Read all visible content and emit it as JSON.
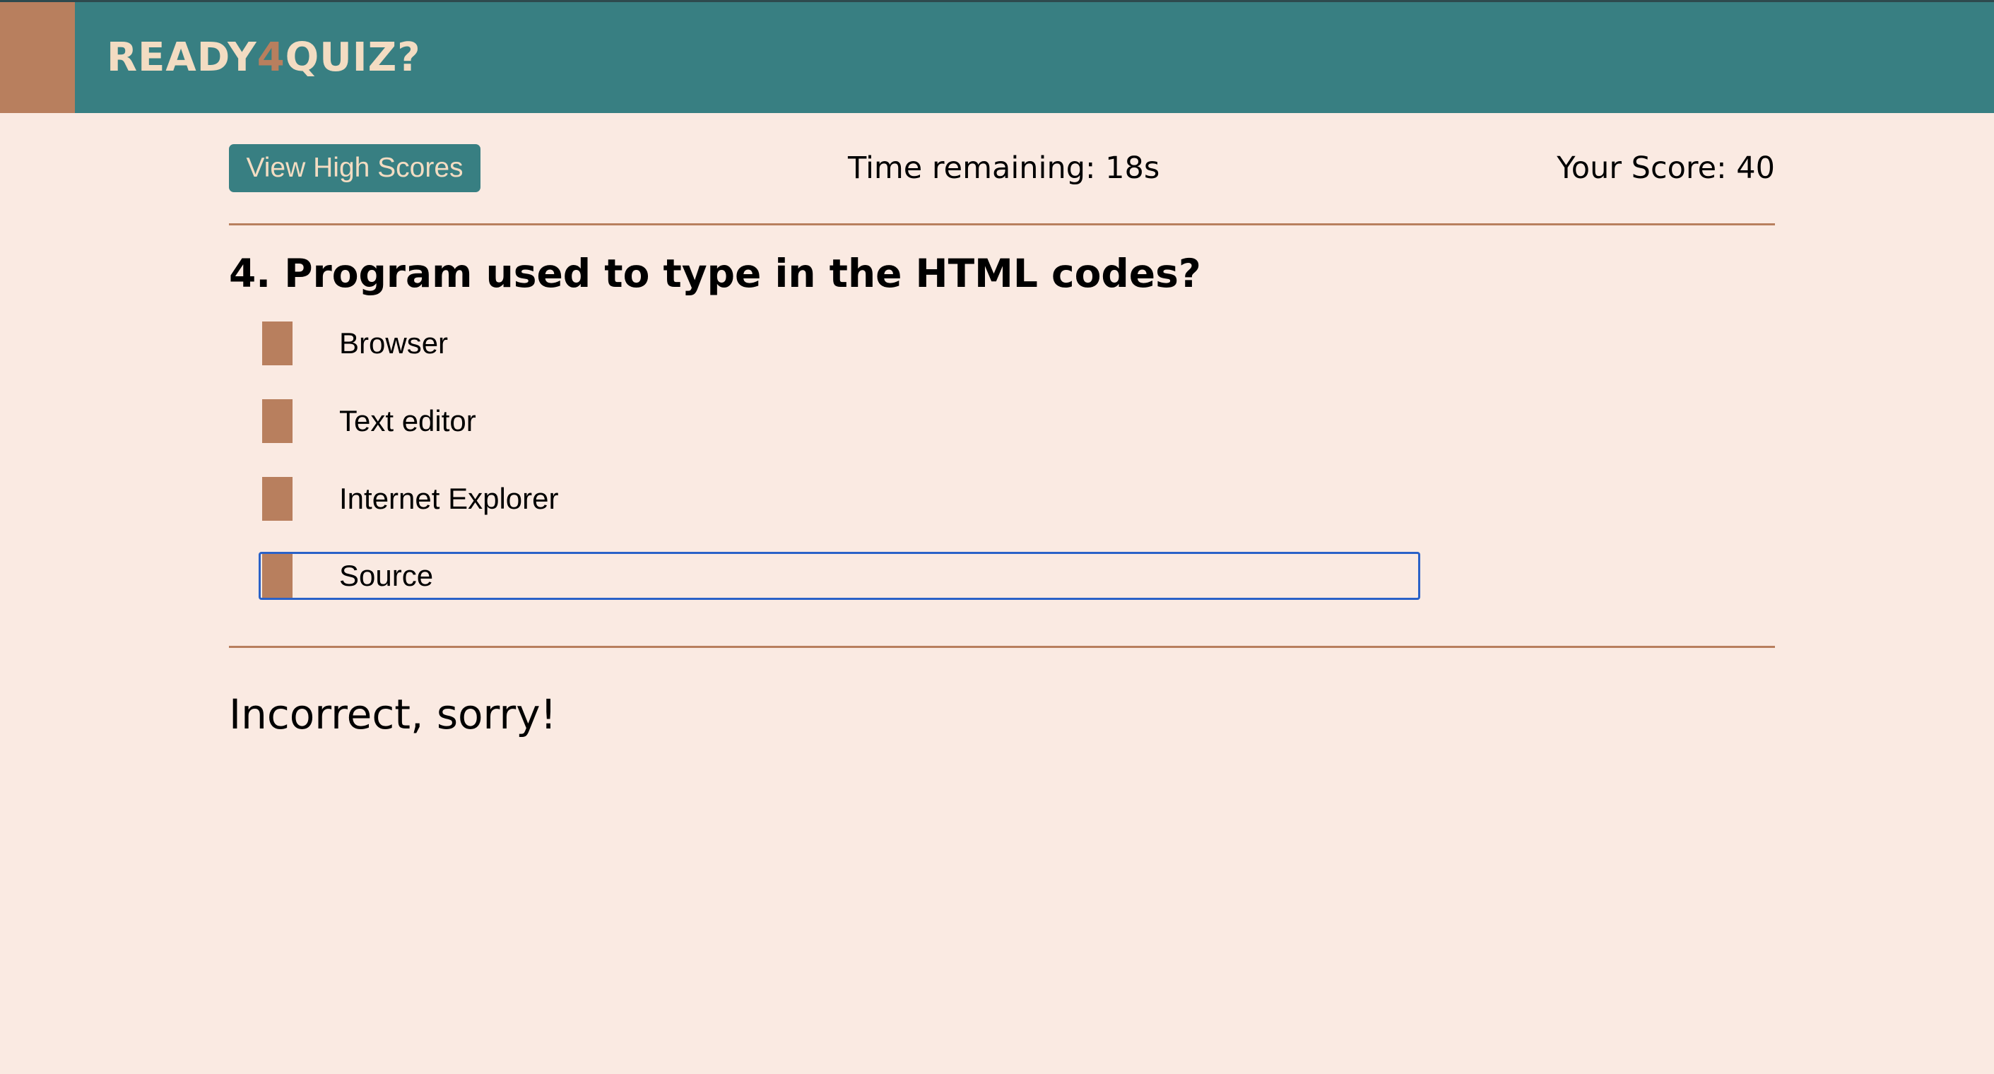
{
  "header": {
    "brand_prefix": "READY",
    "brand_number": "4",
    "brand_suffix": "QUIZ?",
    "colors": {
      "bar": "#387f82",
      "accent": "#b87f5e",
      "brand_text": "#f3dcc2"
    }
  },
  "status": {
    "high_scores_label": "View High Scores",
    "timer_text": "Time remaining: 18s",
    "score_text": "Your Score: 40"
  },
  "question": {
    "text": "4. Program used to type in the HTML codes?",
    "answers": [
      {
        "label": "Browser"
      },
      {
        "label": "Text editor"
      },
      {
        "label": "Internet Explorer"
      },
      {
        "label": "Source"
      }
    ]
  },
  "feedback": {
    "text": "Incorrect, sorry!"
  }
}
